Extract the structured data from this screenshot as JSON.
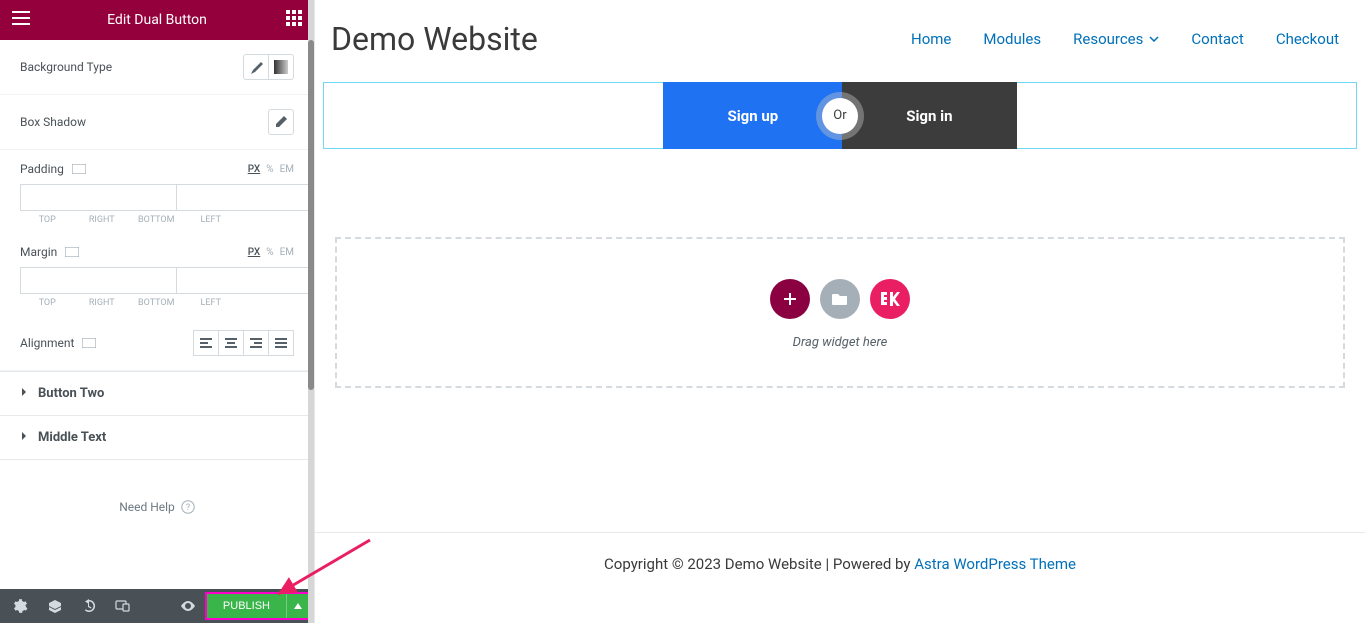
{
  "panel": {
    "title": "Edit Dual Button",
    "background_type_label": "Background Type",
    "box_shadow_label": "Box Shadow",
    "padding_label": "Padding",
    "margin_label": "Margin",
    "units": [
      "PX",
      "%",
      "EM"
    ],
    "dim_labels": [
      "TOP",
      "RIGHT",
      "BOTTOM",
      "LEFT"
    ],
    "alignment_label": "Alignment",
    "accordion1": "Button Two",
    "accordion2": "Middle Text",
    "need_help": "Need Help",
    "publish_label": "PUBLISH"
  },
  "site": {
    "title": "Demo Website",
    "nav": [
      "Home",
      "Modules",
      "Resources",
      "Contact",
      "Checkout"
    ],
    "dual": {
      "left": "Sign up",
      "middle": "Or",
      "right": "Sign in"
    },
    "drop_text": "Drag widget here",
    "footer_prefix": "Copyright © 2023 Demo Website | Powered by ",
    "footer_link": "Astra WordPress Theme"
  }
}
